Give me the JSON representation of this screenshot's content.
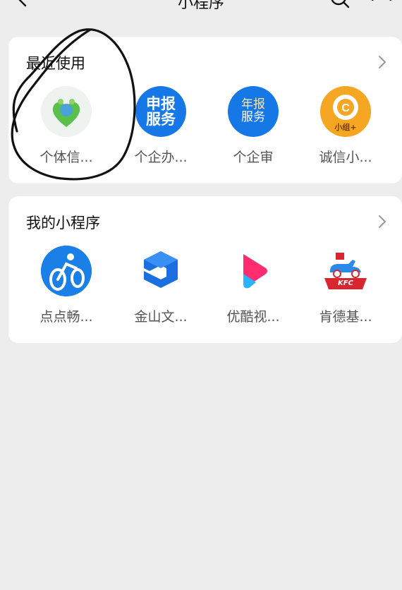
{
  "header": {
    "title": "小程序"
  },
  "recent": {
    "title": "最近使用",
    "apps": [
      {
        "label": "个体信..."
      },
      {
        "label": "个企办...",
        "icon_text_line1": "申报",
        "icon_text_line2": "服务",
        "color": "#1677e6"
      },
      {
        "label": "个企审",
        "icon_text_line1": "年报",
        "icon_text_line2": "服务",
        "color": "#1677e6"
      },
      {
        "label": "诚信小...",
        "icon_text": "小组+",
        "color": "#f5a623"
      }
    ]
  },
  "mine": {
    "title": "我的小程序",
    "apps": [
      {
        "label": "点点畅...",
        "color": "#1a7fe6"
      },
      {
        "label": "金山文...",
        "color": "#1c6fe0"
      },
      {
        "label": "优酷视...",
        "color": "#ff2d6f"
      },
      {
        "label": "肯德基...",
        "icon_text": "KFC",
        "color": "#d6262f"
      }
    ]
  },
  "colors": {
    "background": "#ededed",
    "card": "#ffffff",
    "label_text": "#555555"
  }
}
